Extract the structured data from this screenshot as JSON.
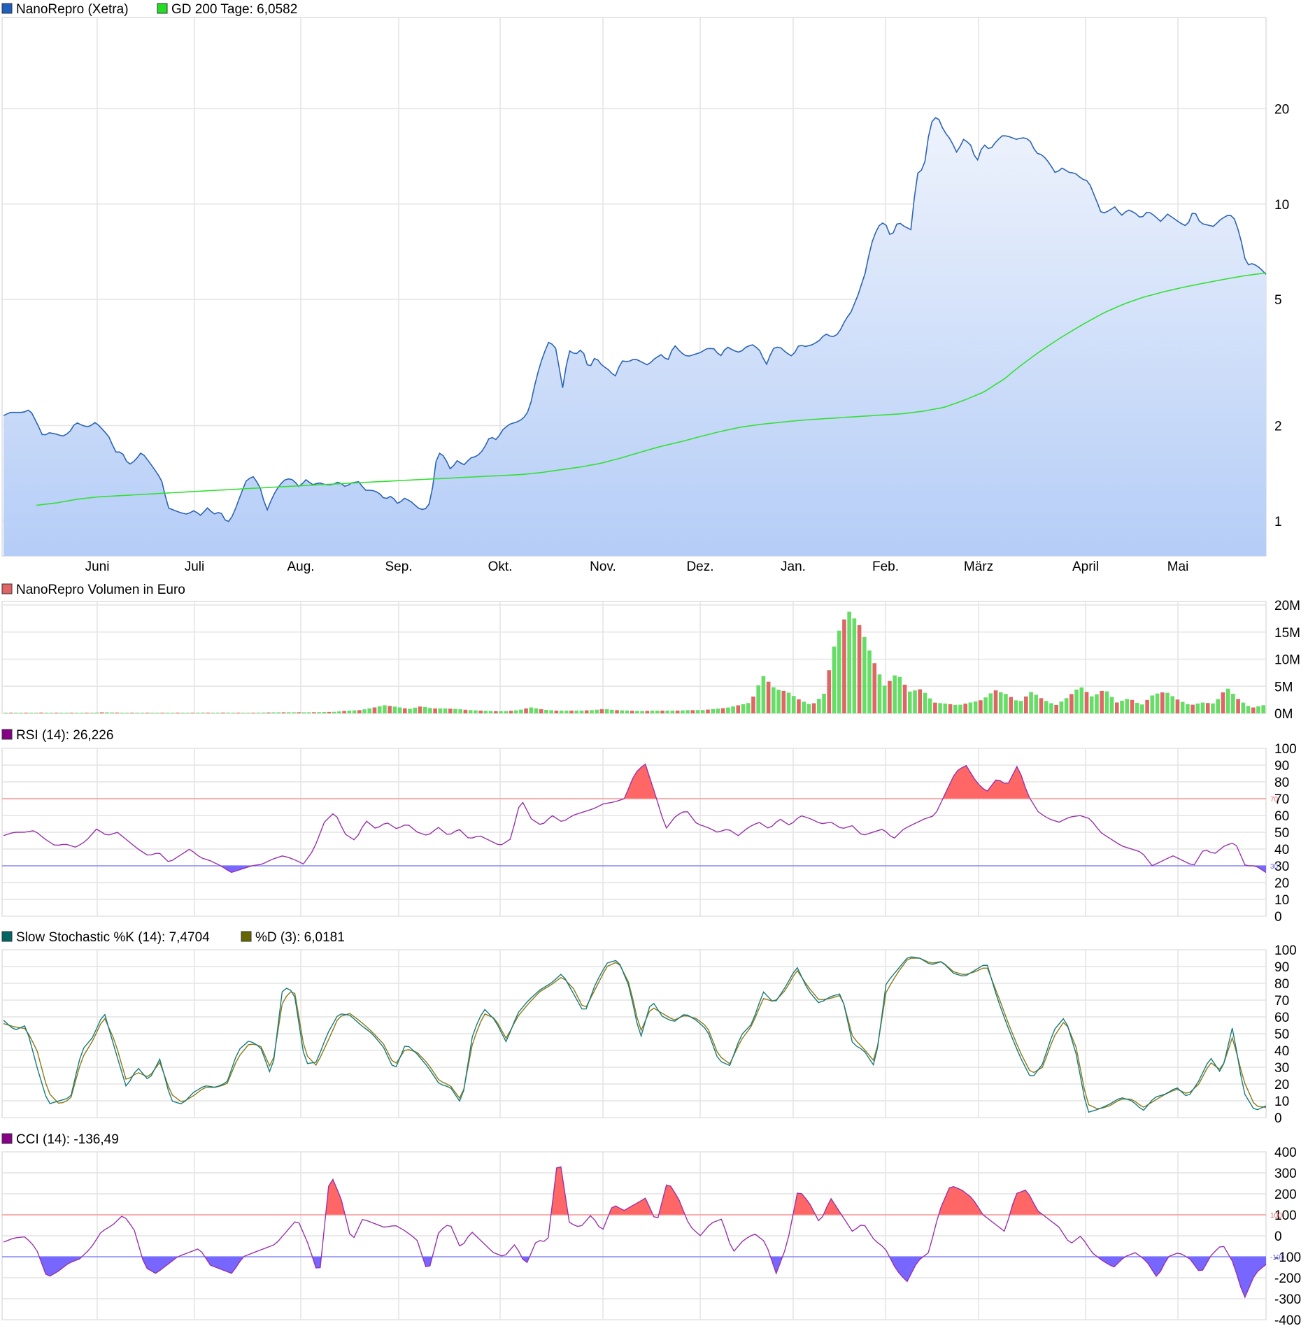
{
  "legends": {
    "price": [
      {
        "label": "NanoRepro (Xetra)",
        "color": "#1f5fbf"
      },
      {
        "label": "GD 200 Tage: 6,0582",
        "color": "#22dd22"
      }
    ],
    "volume": [
      {
        "label": "NanoRepro Volumen in Euro",
        "color": "#e06666"
      }
    ],
    "rsi": [
      {
        "label": "RSI (14): 26,226",
        "color": "#880088"
      }
    ],
    "stoch": [
      {
        "label": "Slow Stochastic %K (14): 7,4704",
        "color": "#006666"
      },
      {
        "label": "%D (3): 6,0181",
        "color": "#666600"
      }
    ],
    "cci": [
      {
        "label": "CCI (14): -136,49",
        "color": "#880088"
      }
    ]
  },
  "x_axis": {
    "months": [
      "Juni",
      "Juli",
      "Aug.",
      "Sep.",
      "Okt.",
      "Nov.",
      "Dez.",
      "Jan.",
      "Feb.",
      "März",
      "April",
      "Mai"
    ]
  },
  "chart_data": [
    {
      "id": "price",
      "type": "line",
      "scale": "log",
      "y_ticks": [
        "20",
        "10",
        "5",
        "2",
        "1"
      ],
      "series": [
        {
          "name": "NanoRepro (Xetra)",
          "values": [
            2.15,
            2.2,
            2.2,
            2.2,
            2.25,
            2.05,
            1.85,
            1.9,
            1.88,
            1.85,
            1.9,
            2.05,
            2.0,
            1.98,
            2.05,
            1.95,
            1.85,
            1.65,
            1.65,
            1.5,
            1.55,
            1.65,
            1.55,
            1.45,
            1.35,
            1.1,
            1.08,
            1.06,
            1.05,
            1.08,
            1.04,
            1.1,
            1.05,
            1.07,
            0.98,
            1.05,
            1.2,
            1.35,
            1.38,
            1.28,
            1.07,
            1.2,
            1.3,
            1.36,
            1.35,
            1.28,
            1.35,
            1.3,
            1.32,
            1.3,
            1.3,
            1.33,
            1.28,
            1.32,
            1.33,
            1.25,
            1.25,
            1.23,
            1.17,
            1.2,
            1.13,
            1.18,
            1.15,
            1.1,
            1.08,
            1.15,
            1.65,
            1.6,
            1.45,
            1.55,
            1.5,
            1.58,
            1.6,
            1.68,
            1.85,
            1.8,
            1.95,
            2.02,
            2.05,
            2.1,
            2.25,
            2.8,
            3.3,
            3.7,
            3.5,
            2.6,
            3.45,
            3.35,
            3.5,
            3.0,
            3.3,
            3.1,
            3.0,
            2.85,
            3.2,
            3.18,
            3.25,
            3.18,
            3.1,
            3.25,
            3.35,
            3.2,
            3.6,
            3.4,
            3.3,
            3.35,
            3.4,
            3.5,
            3.5,
            3.3,
            3.55,
            3.45,
            3.4,
            3.55,
            3.6,
            3.45,
            3.1,
            3.5,
            3.55,
            3.4,
            3.3,
            3.6,
            3.55,
            3.6,
            3.7,
            3.9,
            3.8,
            3.9,
            4.3,
            4.6,
            5.2,
            6.0,
            7.5,
            8.5,
            8.8,
            7.8,
            8.8,
            8.5,
            8.3,
            12.5,
            13.0,
            18.0,
            19.0,
            17.0,
            16.0,
            14.5,
            16.0,
            15.5,
            13.5,
            15.5,
            14.8,
            15.8,
            16.5,
            16.3,
            16.0,
            16.2,
            16.0,
            14.5,
            14.3,
            13.5,
            12.5,
            13.0,
            12.6,
            12.5,
            12.0,
            11.8,
            10.5,
            9.3,
            9.5,
            9.8,
            9.2,
            9.6,
            9.4,
            9.0,
            9.5,
            9.2,
            8.8,
            9.3,
            9.0,
            8.7,
            8.5,
            9.6,
            8.7,
            8.6,
            8.5,
            8.9,
            9.2,
            9.2,
            8.0,
            6.4,
            6.5,
            6.3,
            6.0
          ]
        },
        {
          "name": "GD 200 Tage: 6,0582",
          "values": [
            1.12,
            1.14,
            1.17,
            1.19,
            1.2,
            1.21,
            1.22,
            1.23,
            1.24,
            1.25,
            1.26,
            1.27,
            1.28,
            1.29,
            1.3,
            1.31,
            1.32,
            1.33,
            1.34,
            1.35,
            1.36,
            1.37,
            1.38,
            1.39,
            1.4,
            1.42,
            1.45,
            1.48,
            1.52,
            1.58,
            1.65,
            1.72,
            1.78,
            1.85,
            1.92,
            1.98,
            2.02,
            2.05,
            2.08,
            2.1,
            2.12,
            2.14,
            2.16,
            2.18,
            2.22,
            2.28,
            2.4,
            2.55,
            2.8,
            3.15,
            3.5,
            3.85,
            4.2,
            4.55,
            4.85,
            5.1,
            5.3,
            5.48,
            5.64,
            5.8,
            5.95,
            6.06
          ]
        }
      ]
    },
    {
      "id": "volume",
      "type": "bar",
      "y_ticks": [
        "20M",
        "15M",
        "10M",
        "5M",
        "0M"
      ],
      "ylim": [
        0,
        20
      ],
      "unit": "M",
      "values": [
        0.1,
        0.12,
        0.1,
        0.15,
        0.08,
        0.1,
        0.1,
        0.12,
        0.2,
        0.15,
        0.1,
        0.12,
        0.1,
        0.1,
        0.12,
        0.1,
        0.15,
        0.12,
        0.15,
        0.1,
        0.12,
        0.15,
        0.18,
        0.2,
        0.2,
        0.2,
        0.25,
        0.3,
        0.5,
        0.6,
        1.0,
        1.5,
        1.2,
        0.8,
        1.3,
        0.9,
        0.9,
        0.8,
        0.6,
        0.5,
        0.4,
        0.4,
        0.6,
        1.1,
        0.7,
        0.5,
        0.5,
        0.5,
        0.6,
        0.8,
        0.6,
        0.5,
        0.4,
        0.5,
        0.5,
        0.5,
        0.6,
        0.6,
        0.8,
        1.0,
        1.5,
        2.0,
        7.0,
        4.5,
        4.0,
        2.5,
        1.5,
        3.5,
        14.0,
        19.0,
        16.0,
        10.0,
        5.0,
        7.5,
        4.0,
        4.5,
        2.0,
        1.8,
        1.5,
        2.0,
        2.5,
        4.3,
        3.5,
        2.0,
        4.0,
        2.5,
        1.5,
        3.0,
        5.0,
        3.0,
        4.5,
        2.0,
        2.8,
        1.5,
        3.5,
        4.0,
        2.5,
        1.5,
        2.0,
        1.8,
        4.8,
        2.5,
        1.0,
        1.5
      ]
    },
    {
      "id": "rsi",
      "type": "line",
      "ylim": [
        0,
        100
      ],
      "y_ticks": [
        "100",
        "90",
        "80",
        "70",
        "60",
        "50",
        "40",
        "30",
        "20",
        "10",
        "0"
      ],
      "thresholds": [
        "70",
        "30"
      ],
      "values": [
        48,
        50,
        50,
        51,
        46,
        42,
        43,
        41,
        45,
        52,
        48,
        50,
        45,
        40,
        36,
        38,
        32,
        36,
        40,
        35,
        33,
        30,
        26,
        28,
        30,
        31,
        34,
        36,
        34,
        31,
        40,
        56,
        62,
        49,
        45,
        57,
        52,
        56,
        52,
        55,
        50,
        48,
        53,
        48,
        52,
        46,
        48,
        45,
        42,
        46,
        70,
        58,
        54,
        60,
        56,
        60,
        62,
        64,
        67,
        68,
        70,
        85,
        91,
        72,
        52,
        60,
        63,
        55,
        53,
        50,
        52,
        48,
        53,
        56,
        52,
        58,
        54,
        60,
        58,
        55,
        56,
        52,
        54,
        48,
        50,
        52,
        46,
        52,
        55,
        58,
        60,
        73,
        86,
        90,
        80,
        74,
        82,
        78,
        90,
        72,
        62,
        58,
        56,
        59,
        60,
        58,
        50,
        46,
        42,
        40,
        38,
        30,
        33,
        36,
        33,
        30,
        40,
        37,
        42,
        44,
        30,
        30,
        26
      ]
    },
    {
      "id": "stoch",
      "type": "line",
      "ylim": [
        0,
        100
      ],
      "y_ticks": [
        "100",
        "90",
        "80",
        "70",
        "60",
        "50",
        "40",
        "30",
        "20",
        "10",
        "0"
      ],
      "series": [
        {
          "name": "Slow Stochastic %K (14): 7,4704",
          "values": [
            58,
            52,
            55,
            30,
            8,
            10,
            12,
            40,
            48,
            63,
            40,
            18,
            30,
            22,
            35,
            10,
            8,
            15,
            19,
            18,
            21,
            40,
            46,
            42,
            24,
            78,
            75,
            32,
            33,
            50,
            62,
            61,
            55,
            50,
            42,
            28,
            44,
            38,
            30,
            20,
            18,
            8,
            50,
            65,
            58,
            45,
            62,
            70,
            76,
            80,
            86,
            74,
            62,
            80,
            92,
            94,
            78,
            47,
            70,
            60,
            57,
            62,
            58,
            52,
            34,
            31,
            49,
            56,
            75,
            68,
            78,
            90,
            76,
            68,
            72,
            74,
            44,
            40,
            30,
            80,
            88,
            96,
            95,
            91,
            93,
            86,
            84,
            88,
            92,
            70,
            52,
            36,
            23,
            32,
            52,
            60,
            38,
            3,
            5,
            8,
            12,
            10,
            4,
            12,
            14,
            18,
            12,
            22,
            36,
            26,
            54,
            15,
            4,
            7
          ]
        },
        {
          "name": "%D (3): 6,0181",
          "values": [
            56,
            54,
            53,
            40,
            15,
            8,
            11,
            35,
            46,
            60,
            45,
            22,
            27,
            24,
            33,
            14,
            9,
            13,
            18,
            18,
            20,
            36,
            44,
            43,
            28,
            70,
            77,
            38,
            31,
            45,
            60,
            62,
            57,
            51,
            44,
            31,
            41,
            39,
            32,
            22,
            19,
            10,
            45,
            62,
            59,
            47,
            60,
            68,
            75,
            79,
            84,
            77,
            64,
            77,
            90,
            93,
            80,
            51,
            66,
            62,
            58,
            61,
            59,
            54,
            37,
            32,
            46,
            55,
            71,
            69,
            76,
            88,
            78,
            70,
            71,
            73,
            48,
            41,
            33,
            75,
            86,
            95,
            95,
            92,
            93,
            87,
            85,
            87,
            90,
            73,
            55,
            39,
            26,
            30,
            48,
            58,
            42,
            8,
            5,
            7,
            11,
            11,
            6,
            10,
            14,
            17,
            14,
            20,
            33,
            28,
            48,
            22,
            7,
            6
          ]
        }
      ]
    },
    {
      "id": "cci",
      "type": "line",
      "ylim": [
        -400,
        400
      ],
      "y_ticks": [
        "400",
        "300",
        "200",
        "100",
        "0",
        "-100",
        "-200",
        "-300",
        "-400"
      ],
      "thresholds": [
        "100",
        "-100"
      ],
      "values": [
        -30,
        -10,
        -5,
        -60,
        -200,
        -170,
        -130,
        -110,
        -60,
        20,
        50,
        100,
        30,
        -150,
        -180,
        -140,
        -100,
        -80,
        -60,
        -140,
        -160,
        -180,
        -100,
        -80,
        -60,
        -40,
        20,
        80,
        -40,
        -200,
        300,
        180,
        -30,
        80,
        60,
        40,
        50,
        20,
        -20,
        -180,
        20,
        60,
        -60,
        20,
        -30,
        -80,
        -100,
        -40,
        -140,
        -20,
        -30,
        400,
        60,
        40,
        100,
        20,
        150,
        120,
        150,
        180,
        60,
        260,
        180,
        50,
        0,
        60,
        80,
        -80,
        -20,
        10,
        -30,
        -180,
        -40,
        220,
        160,
        60,
        180,
        100,
        20,
        60,
        -20,
        -60,
        -160,
        -220,
        -120,
        -80,
        120,
        240,
        220,
        180,
        100,
        60,
        20,
        200,
        220,
        120,
        80,
        40,
        -40,
        0,
        -80,
        -120,
        -150,
        -100,
        -80,
        -120,
        -200,
        -100,
        -80,
        -110,
        -180,
        -90,
        -40,
        -130,
        -300,
        -180,
        -136
      ]
    }
  ]
}
